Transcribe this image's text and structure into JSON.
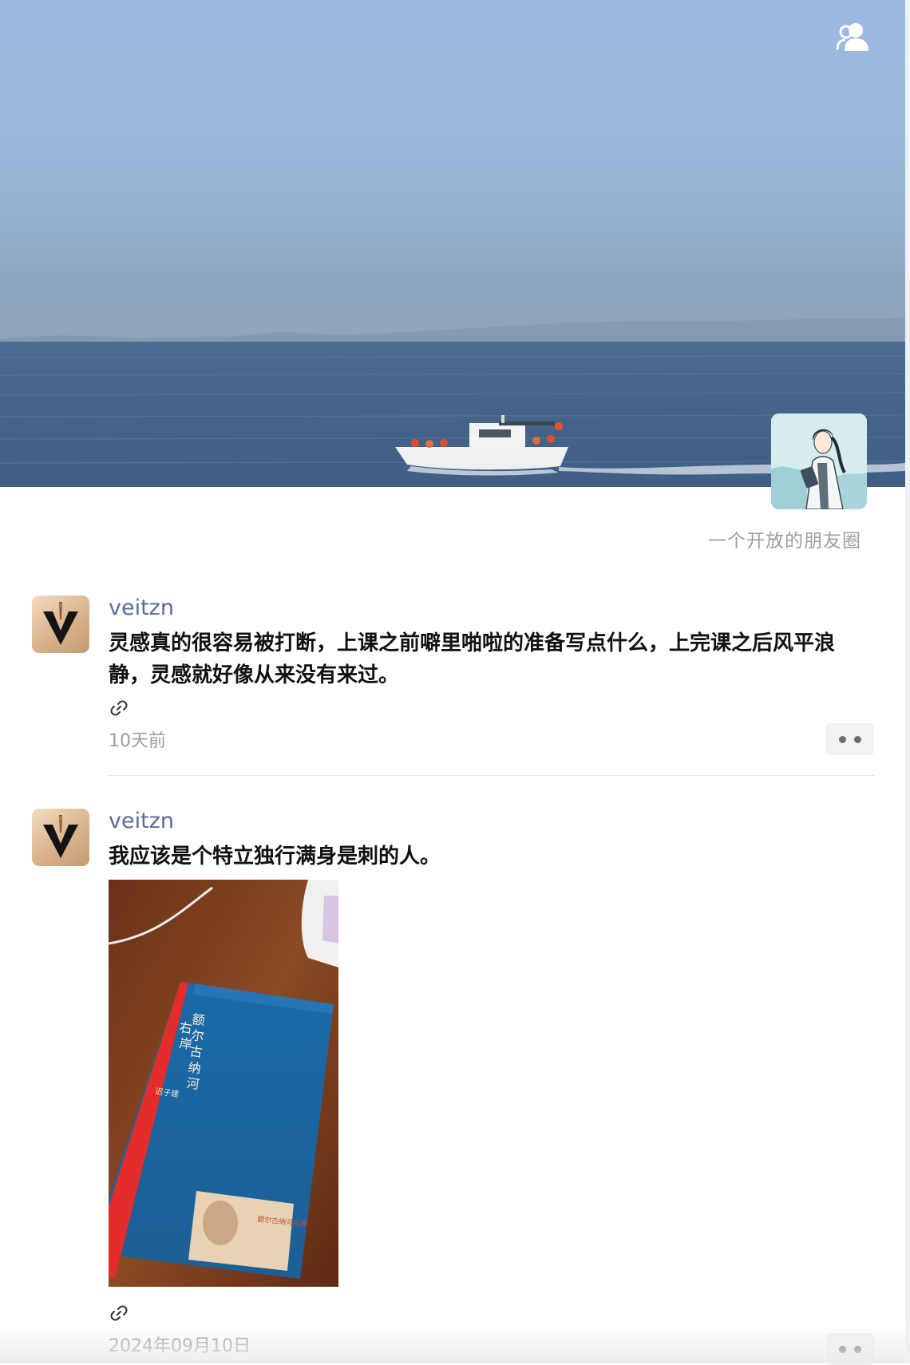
{
  "header": {
    "contacts_icon": "contacts-icon",
    "signature": "一个开放的朋友圈"
  },
  "posts": [
    {
      "author": "veitzn",
      "text": "灵感真的很容易被打断，上课之前噼里啪啦的准备写点什么，上完课之后风平浪静，灵感就好像从来没有来过。",
      "time": "10天前",
      "link_icon": "link-icon",
      "more_icon": "more-icon"
    },
    {
      "author": "veitzn",
      "text": "我应该是个特立独行满身是刺的人。",
      "time": "2024年09月10日",
      "link_icon": "link-icon",
      "more_icon": "more-icon",
      "image_book": {
        "title": "额尔古纳河右岸",
        "author": "迟子建"
      }
    }
  ],
  "colors": {
    "author_name": "#5b6b96",
    "meta_text": "#9a9ea6",
    "post_text": "#111111"
  }
}
